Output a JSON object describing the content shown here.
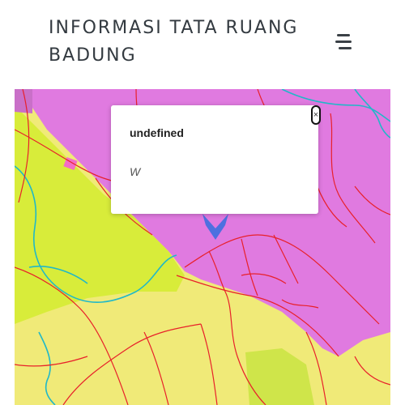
{
  "header": {
    "title": "INFORMASI TATA RUANG BADUNG",
    "menu_icon": "hamburger-menu-icon"
  },
  "map": {
    "zone_colors": {
      "pink": "#e07ae0",
      "lime": "#d8ec3a",
      "yellow": "#f0ea78",
      "roads": "#e8202a",
      "rivers": "#20b8c8",
      "marker": "#3d6fe0"
    }
  },
  "popup": {
    "title": "undefined",
    "body": "W",
    "close_icon": "close-icon"
  },
  "marker": {
    "icon": "map-pin-icon"
  }
}
